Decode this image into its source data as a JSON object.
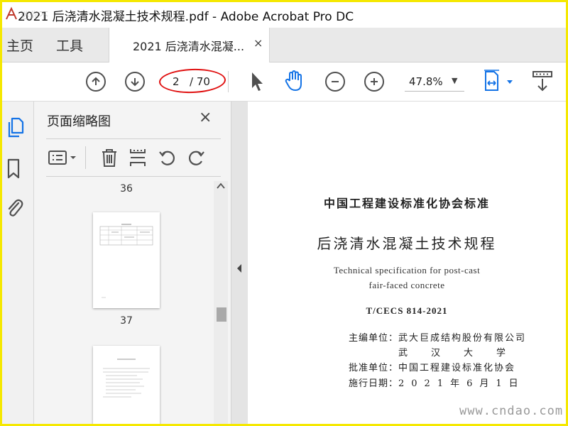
{
  "window": {
    "title": "2021 后浇清水混凝土技术规程.pdf - Adobe Acrobat Pro DC",
    "watermark": "迷你不"
  },
  "tabs": {
    "home": "主页",
    "tools": "工具",
    "document": "2021 后浇清水混凝...",
    "close": "×"
  },
  "toolbar": {
    "current_page": "2",
    "total_pages": "/ 70",
    "zoom": "47.8%"
  },
  "panel": {
    "title": "页面缩略图",
    "close": "×",
    "page_labels": [
      "36",
      "37"
    ]
  },
  "document": {
    "org": "中国工程建设标准化协会标准",
    "title": "后浇清水混凝土技术规程",
    "en_line1": "Technical specification for post-cast",
    "en_line2": "fair-faced concrete",
    "code": "T/CECS 814-2021",
    "editor_label": "主编单位：",
    "editor_value1": "武大巨成结构股份有限公司",
    "editor_value2": "武汉大学",
    "approver_label": "批准单位：",
    "approver_value": "中国工程建设标准化协会",
    "date_label": "施行日期：",
    "date_value": "2021年6月1日"
  },
  "watermark_bottom": "www.cndao.com",
  "colors": {
    "frame": "#f5e800",
    "annotation_oval": "#e01010",
    "accent_icon": "#1473e6"
  }
}
